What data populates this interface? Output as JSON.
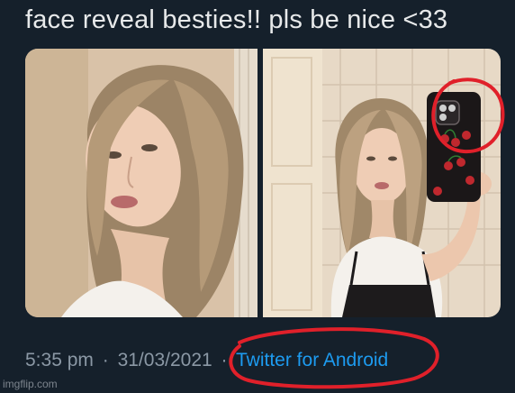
{
  "tweet": {
    "text": "face reveal besties!! pls be nice <33",
    "time": "5:35 pm",
    "separator": "·",
    "date": "31/03/2021",
    "source": "Twitter for Android"
  },
  "media": [
    {
      "alt_name": "photo-left"
    },
    {
      "alt_name": "photo-right"
    }
  ],
  "watermark": "imgflip.com",
  "colors": {
    "background": "#15202b",
    "text": "#e7e9ea",
    "meta": "#8b98a5",
    "link": "#1d9bf0",
    "annotation": "#e0202a"
  }
}
